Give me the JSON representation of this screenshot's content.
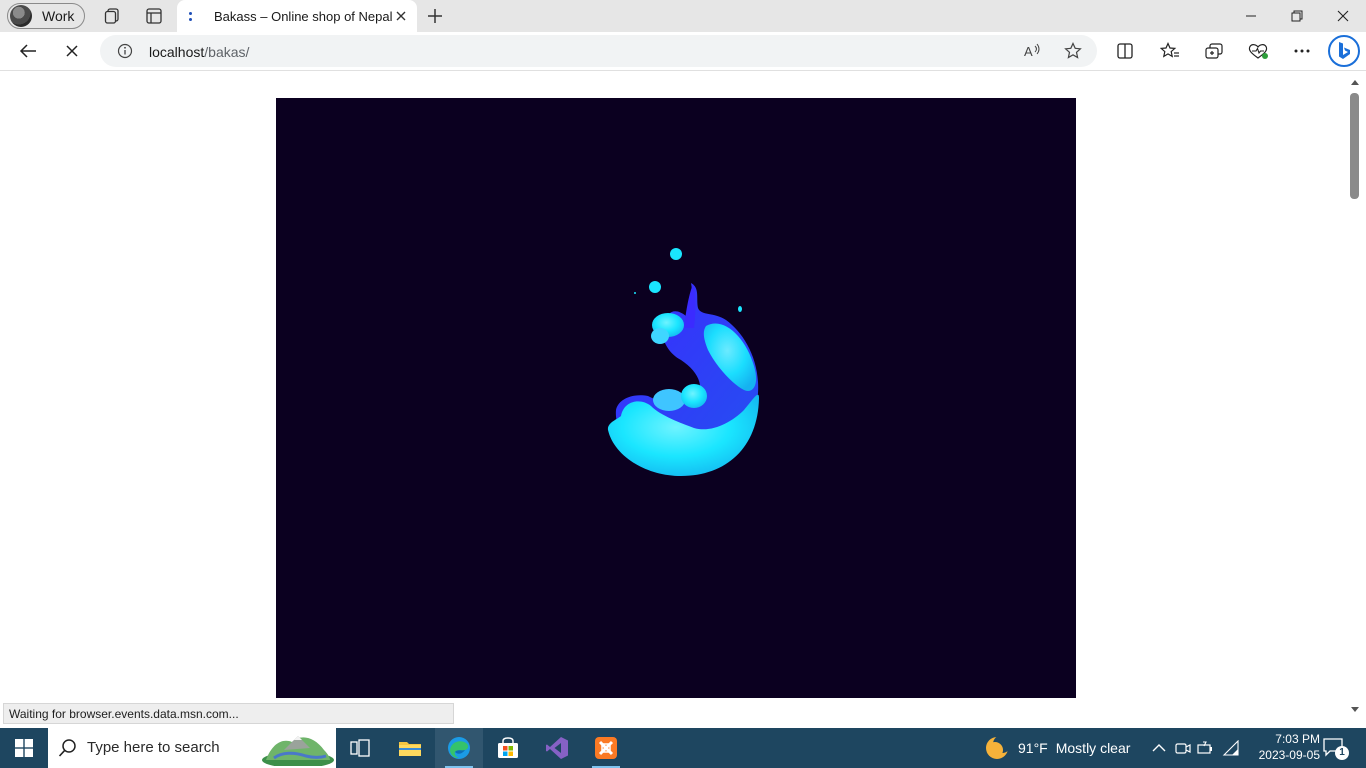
{
  "browser": {
    "profile": {
      "label": "Work"
    },
    "tab": {
      "title": "Bakass – Online shop of Nepal",
      "close_label": "×"
    },
    "address": {
      "host": "localhost",
      "path": "/bakas/"
    },
    "status_text": "Waiting for browser.events.data.msn.com..."
  },
  "taskbar": {
    "search_placeholder": "Type here to search",
    "weather": {
      "temp": "91°F",
      "condition": "Mostly clear"
    },
    "clock": {
      "time": "7:03 PM",
      "date": "2023-09-05"
    },
    "notifications_count": "1"
  },
  "colors": {
    "page_stage_bg": "#0b0020",
    "splash_primary": "#1ae6ff",
    "splash_secondary": "#2a35e8",
    "taskbar_bg": "#1e4660"
  }
}
